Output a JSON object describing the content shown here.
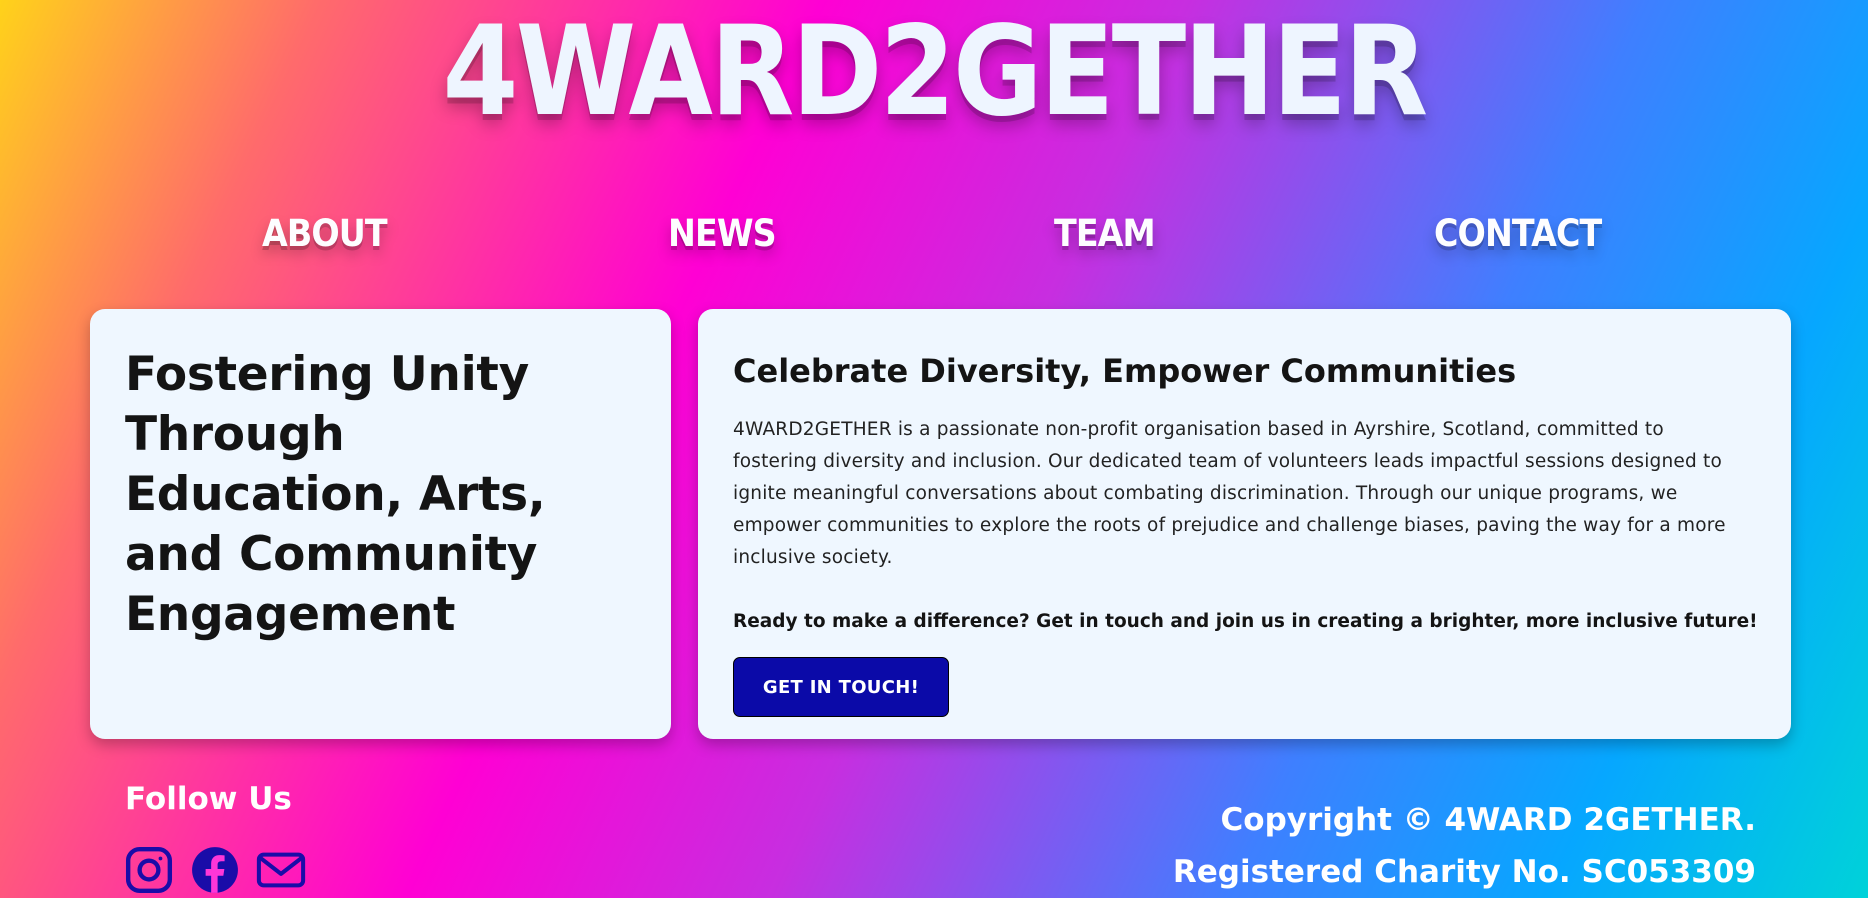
{
  "header": {
    "logo_text": "4WARD2GETHER"
  },
  "nav": {
    "items": [
      {
        "label": "ABOUT"
      },
      {
        "label": "NEWS"
      },
      {
        "label": "TEAM"
      },
      {
        "label": "CONTACT"
      }
    ]
  },
  "hero": {
    "headline": "Fostering Unity Through Education, Arts, and Community Engagement"
  },
  "intro": {
    "title": "Celebrate Diversity, Empower Communities",
    "description": "4WARD2GETHER is a passionate non-profit organisation based in Ayrshire, Scotland, committed to fostering diversity and inclusion. Our dedicated team of volunteers leads impactful sessions designed to ignite meaningful conversations about combating discrimination. Through our unique programs, we empower communities to explore the roots of prejudice and challenge biases, paving the way for a more inclusive society.",
    "cta_text": "Ready to make a difference? Get in touch and join us in creating a brighter, more inclusive future!",
    "cta_button": "GET IN TOUCH!"
  },
  "footer": {
    "follow_title": "Follow Us",
    "social_icons": [
      "instagram-icon",
      "facebook-icon",
      "email-icon"
    ],
    "copyright_line1": "Copyright © 4WARD 2GETHER.",
    "copyright_line2": "Registered Charity No. SC053309"
  },
  "colors": {
    "card_background": "#eff7ff",
    "button_background": "#0b0aa8",
    "social_icon_color": "#1a0ca8",
    "heading_text": "#141414"
  }
}
